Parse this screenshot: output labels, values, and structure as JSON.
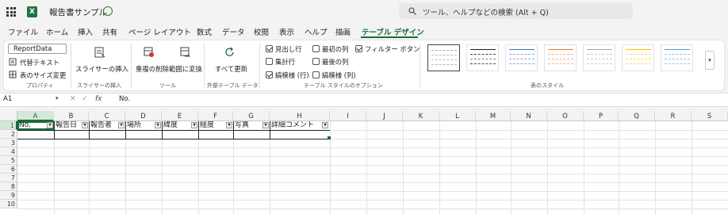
{
  "app": {
    "title": "報告書サンプル"
  },
  "search": {
    "placeholder": "ツール、ヘルプなどの検索 (Alt + Q)"
  },
  "tabs": [
    "ファイル",
    "ホーム",
    "挿入",
    "共有",
    "ページ レイアウト",
    "数式",
    "データ",
    "校閲",
    "表示",
    "ヘルプ",
    "描画",
    "テーブル デザイン"
  ],
  "active_tab": "テーブル デザイン",
  "ribbon": {
    "properties": {
      "table_name": "ReportData",
      "alt_text": "代替テキスト",
      "resize": "表のサイズ変更",
      "label": "プロパティ"
    },
    "slicer": {
      "insert": "スライサーの挿入",
      "label": "スライサーの挿入"
    },
    "tools": {
      "remove_duplicates": "重複の削除",
      "convert_range": "範囲に変換",
      "label": "ツール"
    },
    "external": {
      "refresh": "すべて更新",
      "label": "外部テーブル データ"
    },
    "style_options": {
      "label": "テーブル スタイルのオプション",
      "header_row": "見出し行",
      "total_row": "集計行",
      "banded_rows": "縞模様 (行)",
      "first_column": "最初の列",
      "last_column": "最後の列",
      "banded_columns": "縞模様 (列)",
      "filter_button": "フィルター ボタン"
    },
    "styles": {
      "label": "表のスタイル"
    }
  },
  "formula_bar": {
    "name_box": "A1",
    "fx": "fx",
    "content": "No."
  },
  "columns": [
    "A",
    "B",
    "C",
    "D",
    "E",
    "F",
    "G",
    "H",
    "I",
    "J",
    "K",
    "L",
    "M",
    "N",
    "O",
    "P",
    "Q",
    "R",
    "S"
  ],
  "rows": [
    "1",
    "2",
    "3",
    "4",
    "5",
    "6",
    "7",
    "8",
    "9",
    "10"
  ],
  "table_headers": [
    "No.",
    "報告日",
    "報告者",
    "場所",
    "緯度",
    "経度",
    "写真",
    "詳細コメント"
  ],
  "colors": {
    "accent": "#1a6b3b",
    "excel_green": "#1f7244"
  }
}
